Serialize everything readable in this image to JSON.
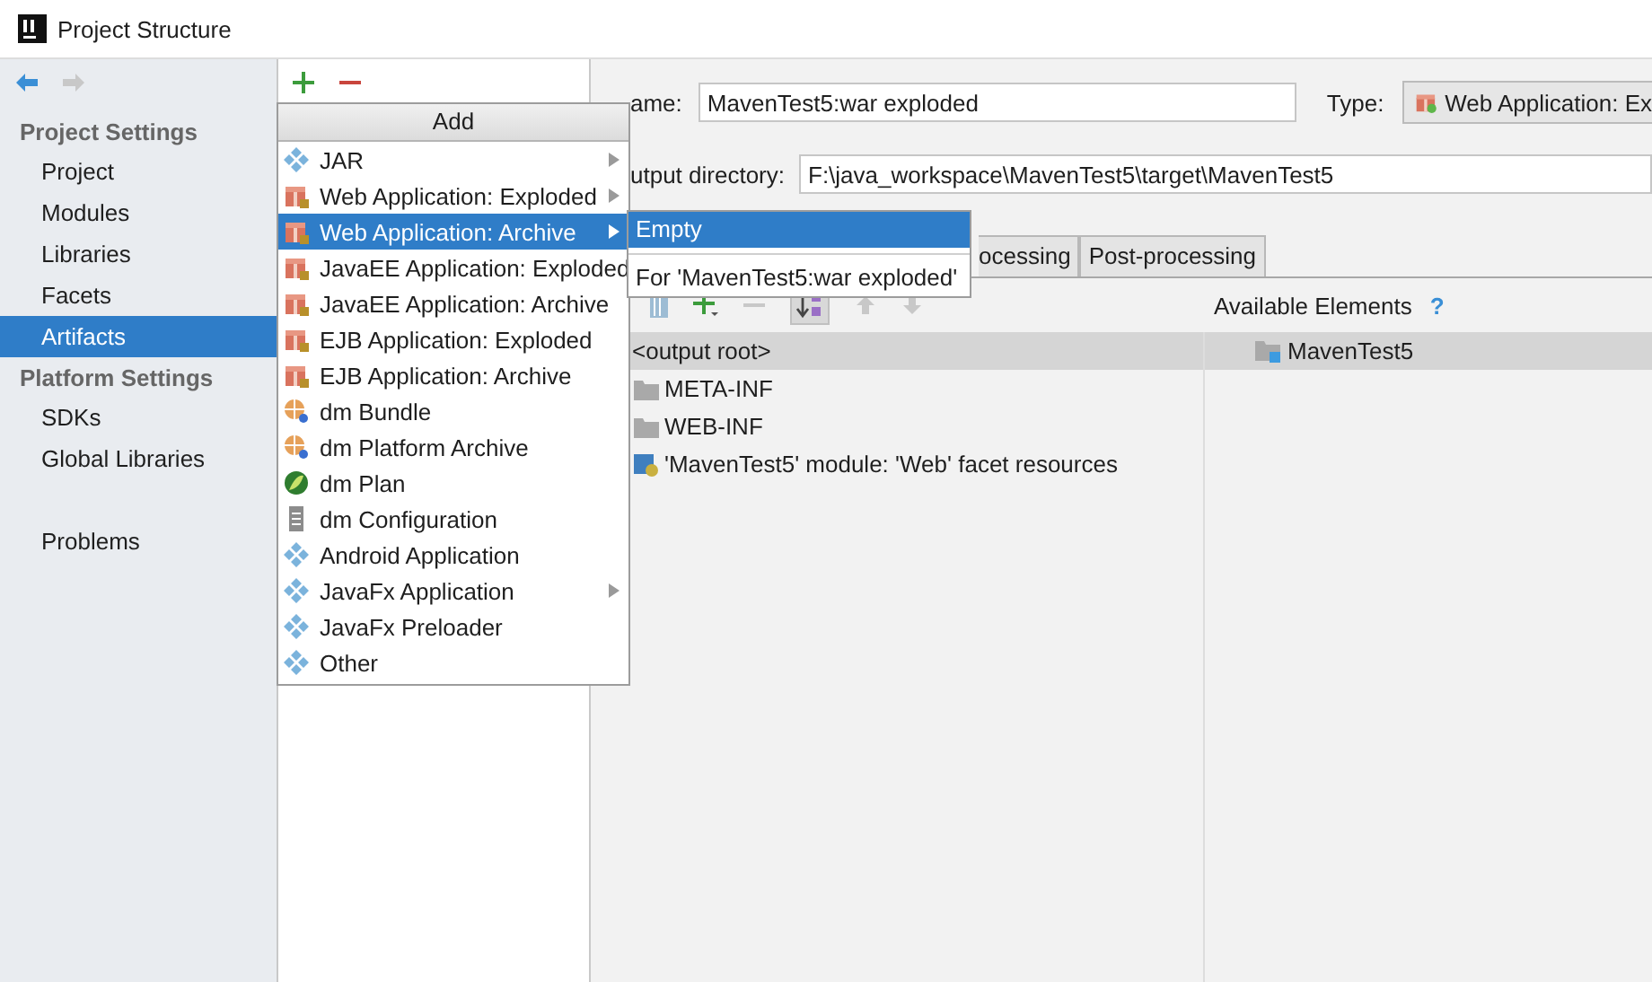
{
  "window": {
    "title": "Project Structure"
  },
  "sidebar": {
    "sections": [
      {
        "heading": "Project Settings",
        "items": [
          {
            "label": "Project",
            "selected": false
          },
          {
            "label": "Modules",
            "selected": false
          },
          {
            "label": "Libraries",
            "selected": false
          },
          {
            "label": "Facets",
            "selected": false
          },
          {
            "label": "Artifacts",
            "selected": true
          }
        ]
      },
      {
        "heading": "Platform Settings",
        "items": [
          {
            "label": "SDKs",
            "selected": false
          },
          {
            "label": "Global Libraries",
            "selected": false
          }
        ]
      }
    ],
    "footer_items": [
      {
        "label": "Problems",
        "selected": false
      }
    ]
  },
  "main": {
    "name_label": "ame:",
    "name_value": "MavenTest5:war exploded",
    "type_label": "Type:",
    "type_value": "Web Application: Ex",
    "output_label": "utput directory:",
    "output_value": "F:\\java_workspace\\MavenTest5\\target\\MavenTest5",
    "tabs": [
      {
        "label": "ocessing",
        "selected": false
      },
      {
        "label": "Post-processing",
        "selected": false
      }
    ],
    "available_label": "Available Elements",
    "help": "?",
    "output_tree": [
      {
        "label": "<output root>",
        "kind": "root",
        "selected": true
      },
      {
        "label": "META-INF",
        "kind": "folder",
        "selected": false
      },
      {
        "label": "WEB-INF",
        "kind": "folder",
        "selected": false
      },
      {
        "label": "'MavenTest5' module: 'Web' facet resources",
        "kind": "facet",
        "selected": false
      }
    ],
    "available": [
      {
        "label": "MavenTest5",
        "selected": true
      }
    ]
  },
  "add_menu": {
    "title": "Add",
    "items": [
      {
        "label": "JAR",
        "kind": "diamond",
        "submenu": true,
        "selected": false
      },
      {
        "label": "Web Application: Exploded",
        "kind": "gift",
        "submenu": true,
        "selected": false
      },
      {
        "label": "Web Application: Archive",
        "kind": "gift",
        "submenu": true,
        "selected": true
      },
      {
        "label": "JavaEE Application: Exploded",
        "kind": "gift",
        "submenu": false,
        "selected": false
      },
      {
        "label": "JavaEE Application: Archive",
        "kind": "gift",
        "submenu": false,
        "selected": false
      },
      {
        "label": "EJB Application: Exploded",
        "kind": "gift",
        "submenu": false,
        "selected": false
      },
      {
        "label": "EJB Application: Archive",
        "kind": "gift",
        "submenu": false,
        "selected": false
      },
      {
        "label": "dm Bundle",
        "kind": "globe",
        "submenu": false,
        "selected": false
      },
      {
        "label": "dm Platform Archive",
        "kind": "globe",
        "submenu": false,
        "selected": false
      },
      {
        "label": "dm Plan",
        "kind": "plan",
        "submenu": false,
        "selected": false
      },
      {
        "label": "dm Configuration",
        "kind": "file",
        "submenu": false,
        "selected": false
      },
      {
        "label": "Android Application",
        "kind": "diamond",
        "submenu": false,
        "selected": false
      },
      {
        "label": "JavaFx Application",
        "kind": "diamond",
        "submenu": true,
        "selected": false
      },
      {
        "label": "JavaFx Preloader",
        "kind": "diamond",
        "submenu": false,
        "selected": false
      },
      {
        "label": "Other",
        "kind": "diamond",
        "submenu": false,
        "selected": false
      }
    ]
  },
  "submenu": {
    "items": [
      {
        "label": "Empty",
        "selected": true
      },
      {
        "label": "For 'MavenTest5:war exploded'",
        "selected": false
      }
    ]
  }
}
